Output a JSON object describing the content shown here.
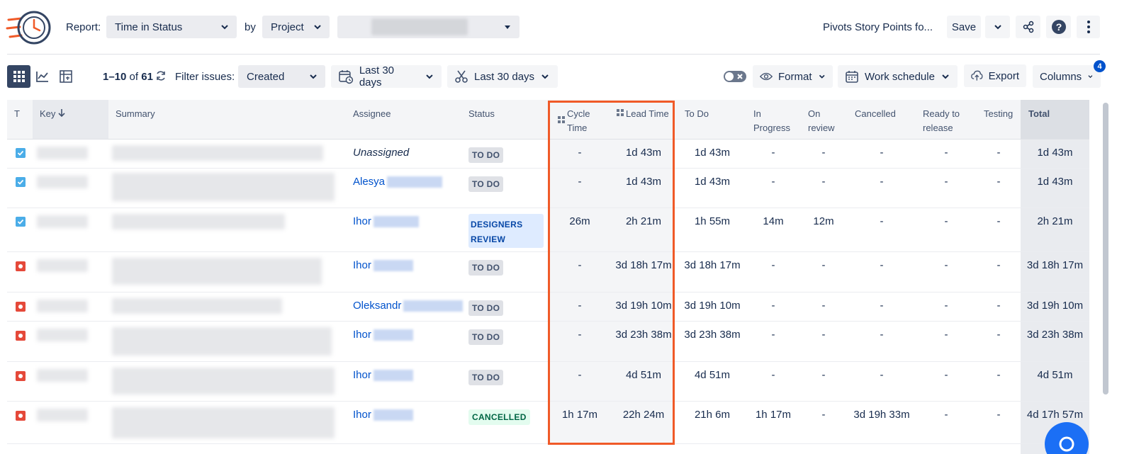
{
  "header": {
    "report_label": "Report:",
    "report_value": "Time in Status",
    "by_label": "by",
    "group_value": "Project",
    "pivot_title": "Pivots Story Points fo...",
    "save_label": "Save"
  },
  "toolbar": {
    "range_start": "1–10",
    "range_of": "of",
    "range_total": "61",
    "filter_label": "Filter issues:",
    "filter_value": "Created",
    "date_filter_1": "Last 30 days",
    "date_filter_2": "Last 30 days",
    "format_label": "Format",
    "work_schedule_label": "Work schedule",
    "export_label": "Export",
    "columns_label": "Columns",
    "columns_badge": "4"
  },
  "table": {
    "headers": {
      "t": "T",
      "key": "Key",
      "summary": "Summary",
      "assignee": "Assignee",
      "status": "Status",
      "cycle_time_1": "Cycle",
      "cycle_time_2": "Time",
      "lead_time": "Lead Time",
      "todo": "To Do",
      "in_progress_1": "In",
      "in_progress_2": "Progress",
      "on_review_1": "On",
      "on_review_2": "review",
      "cancelled": "Cancelled",
      "ready_1": "Ready to",
      "ready_2": "release",
      "testing": "Testing",
      "total": "Total"
    },
    "rows": [
      {
        "type": "task",
        "assignee": "Unassigned",
        "status": "TO DO",
        "cycle": "-",
        "lead": "1d 43m",
        "todo": "1d 43m",
        "inprog": "-",
        "review": "-",
        "cancelled": "-",
        "ready": "-",
        "testing": "-",
        "total": "1d 43m"
      },
      {
        "type": "task",
        "assignee": "Alesya",
        "status": "TO DO",
        "cycle": "-",
        "lead": "1d 43m",
        "todo": "1d 43m",
        "inprog": "-",
        "review": "-",
        "cancelled": "-",
        "ready": "-",
        "testing": "-",
        "total": "1d 43m"
      },
      {
        "type": "task",
        "assignee": "Ihor",
        "status_1": "DESIGNERS",
        "status_2": "REVIEW",
        "cycle": "26m",
        "lead": "2h 21m",
        "todo": "1h 55m",
        "inprog": "14m",
        "review": "12m",
        "cancelled": "-",
        "ready": "-",
        "testing": "-",
        "total": "2h 21m"
      },
      {
        "type": "bug",
        "assignee": "Ihor",
        "status": "TO DO",
        "cycle": "-",
        "lead": "3d 18h 17m",
        "todo": "3d 18h 17m",
        "inprog": "-",
        "review": "-",
        "cancelled": "-",
        "ready": "-",
        "testing": "-",
        "total": "3d 18h 17m"
      },
      {
        "type": "bug",
        "assignee": "Oleksandr",
        "status": "TO DO",
        "cycle": "-",
        "lead": "3d 19h 10m",
        "todo": "3d 19h 10m",
        "inprog": "-",
        "review": "-",
        "cancelled": "-",
        "ready": "-",
        "testing": "-",
        "total": "3d 19h 10m"
      },
      {
        "type": "bug",
        "assignee": "Ihor",
        "status": "TO DO",
        "cycle": "-",
        "lead": "3d 23h 38m",
        "todo": "3d 23h 38m",
        "inprog": "-",
        "review": "-",
        "cancelled": "-",
        "ready": "-",
        "testing": "-",
        "total": "3d 23h 38m"
      },
      {
        "type": "bug",
        "assignee": "Ihor",
        "status": "TO DO",
        "cycle": "-",
        "lead": "4d 51m",
        "todo": "4d 51m",
        "inprog": "-",
        "review": "-",
        "cancelled": "-",
        "ready": "-",
        "testing": "-",
        "total": "4d 51m"
      },
      {
        "type": "bug",
        "assignee": "Ihor",
        "status": "CANCELLED",
        "cycle": "1h 17m",
        "lead": "22h 24m",
        "todo": "21h 6m",
        "inprog": "1h 17m",
        "review": "-",
        "cancelled": "3d 19h 33m",
        "ready": "-",
        "testing": "-",
        "total": "4d 17h 57m"
      }
    ]
  },
  "colors": {
    "accent": "#0052cc",
    "highlight": "#f05a28",
    "task": "#4bade8",
    "bug": "#e5493a"
  }
}
